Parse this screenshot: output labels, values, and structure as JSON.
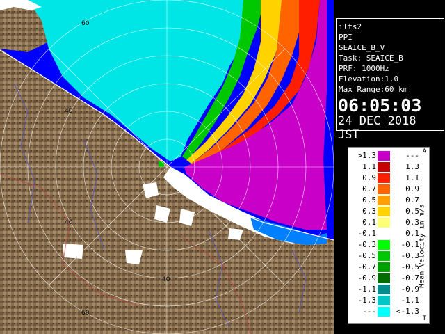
{
  "station": "ilts2",
  "product": "PPI",
  "scan_name": "SEAICE_B_V",
  "task": "Task: SEAICE_B",
  "prf": "PRF: 1000Hz",
  "elevation": "Elevation:1.0",
  "max_range": "Max Range:60 km",
  "time": "06:05:03",
  "date": "24 DEC 2018 JST",
  "range_labels": [
    "60",
    "40",
    "40",
    "40",
    "60"
  ],
  "legend": {
    "title": "Mean Velocity in m/s",
    "top_cap": "A",
    "bottom_cap": "T",
    "rows": [
      {
        "lo": ">1.3",
        "hi": "---",
        "color": "#c800c8"
      },
      {
        "lo": "1.1",
        "hi": "1.3",
        "color": "#c80000"
      },
      {
        "lo": "0.9",
        "hi": "1.1",
        "color": "#ff1e00"
      },
      {
        "lo": "0.7",
        "hi": "0.9",
        "color": "#ff6400"
      },
      {
        "lo": "0.5",
        "hi": "0.7",
        "color": "#ffa000"
      },
      {
        "lo": "0.3",
        "hi": "0.5",
        "color": "#ffd200"
      },
      {
        "lo": "0.1",
        "hi": "0.3",
        "color": "#ffff78"
      },
      {
        "lo": "-0.1",
        "hi": "0.1",
        "color": "#ffffff"
      },
      {
        "lo": "-0.3",
        "hi": "-0.1",
        "color": "#00ff00"
      },
      {
        "lo": "-0.5",
        "hi": "-0.3",
        "color": "#00c800"
      },
      {
        "lo": "-0.7",
        "hi": "-0.5",
        "color": "#00a000"
      },
      {
        "lo": "-0.9",
        "hi": "-0.7",
        "color": "#006e00"
      },
      {
        "lo": "-1.1",
        "hi": "-0.9",
        "color": "#008c8c"
      },
      {
        "lo": "-1.3",
        "hi": "-1.1",
        "color": "#00c8c8"
      },
      {
        "lo": "---",
        "hi": "<-1.3",
        "color": "#00ffff"
      }
    ]
  },
  "colors": {
    "terrain": "#8a7052",
    "outgoing_region": "#c800c8",
    "incoming_region": "#00e6e6",
    "ocean_background": "#0000ff",
    "range_rings": "#ffffff"
  }
}
